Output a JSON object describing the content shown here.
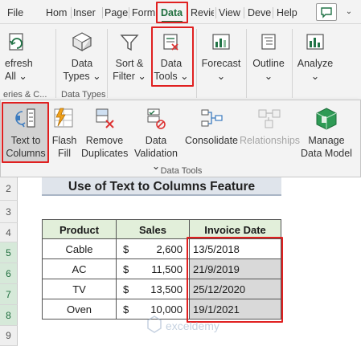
{
  "tabs": [
    "File",
    "Hom",
    "Inser",
    "Page",
    "Form",
    "Data",
    "Revie",
    "View",
    "Deve",
    "Help"
  ],
  "active_tab": "Data",
  "ribbon": {
    "queries": {
      "refresh_line1": "efresh",
      "refresh_line2": "All",
      "group_label": "eries & C..."
    },
    "data_types": {
      "label_line1": "Data",
      "label_line2": "Types",
      "group_label": "Data Types"
    },
    "sort_filter": {
      "label_line1": "Sort &",
      "label_line2": "Filter"
    },
    "data_tools": {
      "label_line1": "Data",
      "label_line2": "Tools"
    },
    "forecast": {
      "label": "Forecast"
    },
    "outline": {
      "label": "Outline"
    },
    "analyze": {
      "label": "Analyze"
    }
  },
  "popup": {
    "group_label": "Data Tools",
    "buttons": {
      "text_to_columns": {
        "line1": "Text to",
        "line2": "Columns"
      },
      "flash_fill": {
        "line1": "Flash",
        "line2": "Fill"
      },
      "remove_duplicates": {
        "line1": "Remove",
        "line2": "Duplicates"
      },
      "data_validation": {
        "line1": "Data",
        "line2": "Validation"
      },
      "consolidate": {
        "line1": "Consolidate"
      },
      "relationships": {
        "line1": "Relationships"
      },
      "manage_data_model": {
        "line1": "Manage",
        "line2": "Data Model"
      }
    }
  },
  "sheet": {
    "row_numbers": [
      "2",
      "3",
      "4",
      "5",
      "6",
      "7",
      "8",
      "9"
    ],
    "title": "Use of Text to Columns Feature",
    "headers": [
      "Product",
      "Sales",
      "Invoice Date"
    ],
    "rows": [
      {
        "product": "Cable",
        "currency": "$",
        "amount": "2,600",
        "date": "13/5/2018"
      },
      {
        "product": "AC",
        "currency": "$",
        "amount": "11,500",
        "date": "21/9/2019"
      },
      {
        "product": "TV",
        "currency": "$",
        "amount": "13,500",
        "date": "25/12/2020"
      },
      {
        "product": "Oven",
        "currency": "$",
        "amount": "10,000",
        "date": "19/1/2021"
      }
    ],
    "watermark_text": "exceldemy"
  },
  "colors": {
    "accent": "#217346",
    "highlight": "#e02020",
    "header_fill": "#e2efda",
    "title_fill": "#dfe4eb"
  }
}
